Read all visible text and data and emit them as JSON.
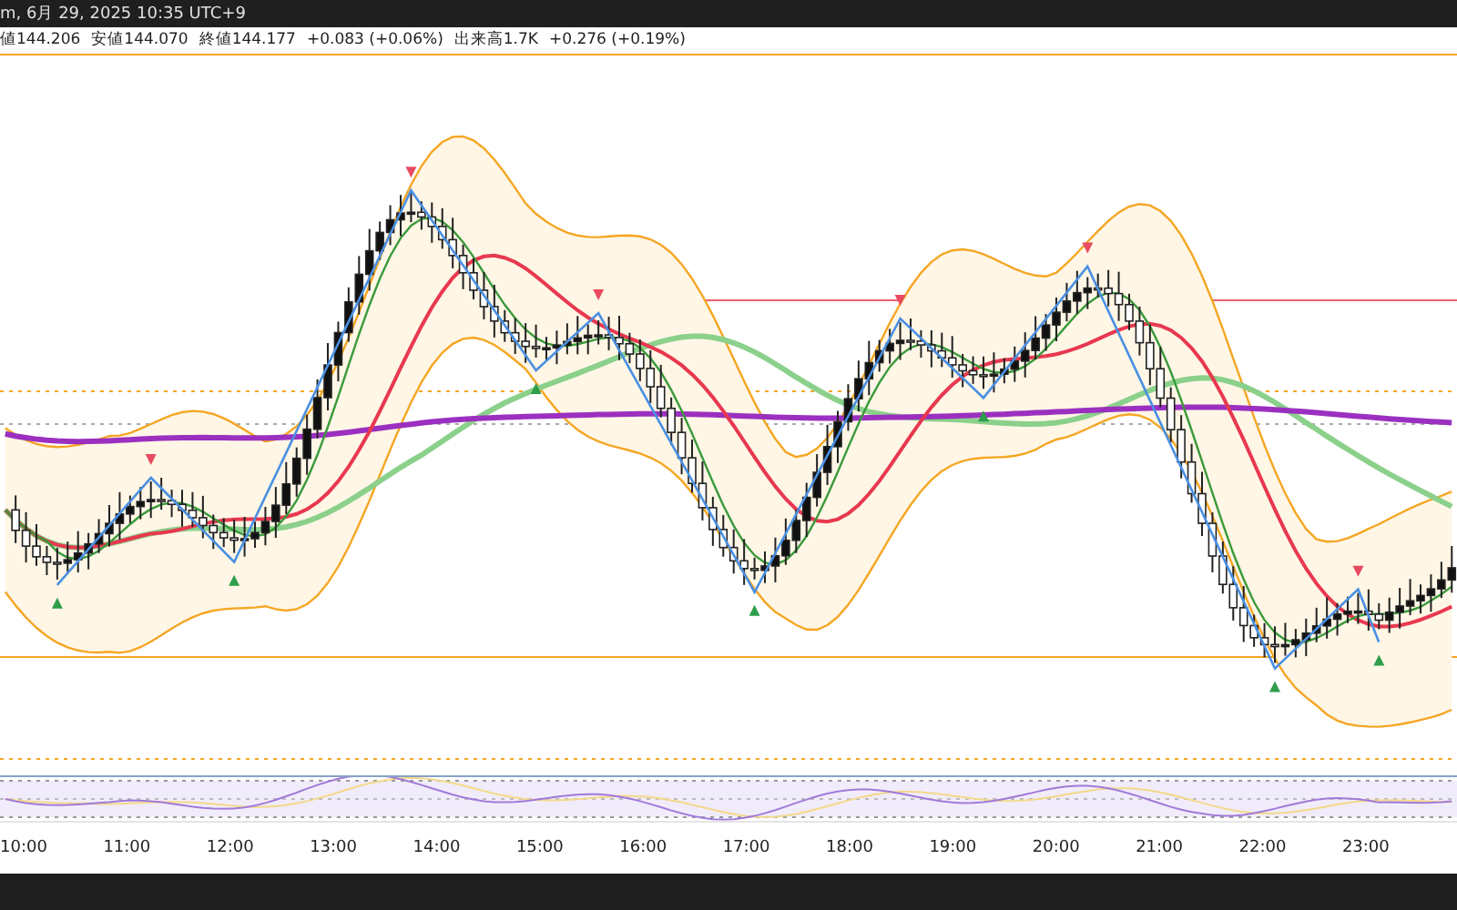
{
  "title_bar": {
    "text": "m, 6月 29, 2025 10:35 UTC+9"
  },
  "legend": {
    "items": [
      "値144.206",
      "安値144.070",
      "終値144.177",
      "+0.083 (+0.06%)",
      "出来高1.7K",
      "+0.276 (+0.19%)"
    ]
  },
  "time_axis": {
    "labels": [
      "10:00",
      "11:00",
      "12:00",
      "13:00",
      "14:00",
      "15:00",
      "16:00",
      "17:00",
      "18:00",
      "19:00",
      "20:00",
      "21:00",
      "22:00",
      "23:00"
    ]
  }
}
